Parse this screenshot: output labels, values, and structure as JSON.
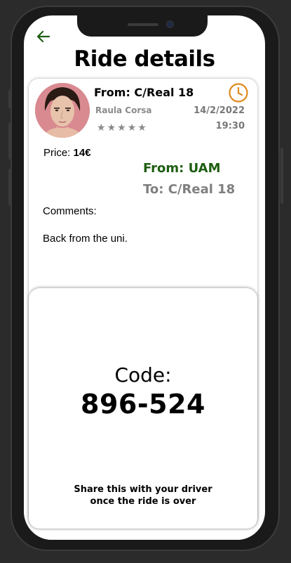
{
  "header": {
    "title": "Ride details"
  },
  "ride": {
    "from_header": "From: C/Real 18",
    "driver_name": "Raula Corsa",
    "date": "14/2/2022",
    "time": "19:30",
    "rating": 5,
    "price_label": "Price: ",
    "price_value": "14€",
    "route_from": "From: UAM",
    "route_to": "To: C/Real 18",
    "comments_label": "Comments:",
    "comments_text": "Back from the uni."
  },
  "code_panel": {
    "label": "Code:",
    "code": "896-524",
    "hint_line1": "Share this with your driver",
    "hint_line2": "once the ride is over"
  },
  "icons": {
    "back": "arrow-left-icon",
    "clock": "clock-icon",
    "star": "star-icon"
  },
  "colors": {
    "back_arrow": "#1e5e12",
    "clock": "#e08a1e",
    "route_from": "#1e5e12",
    "route_to": "#7f7f7f",
    "muted": "#8a8a8a"
  }
}
